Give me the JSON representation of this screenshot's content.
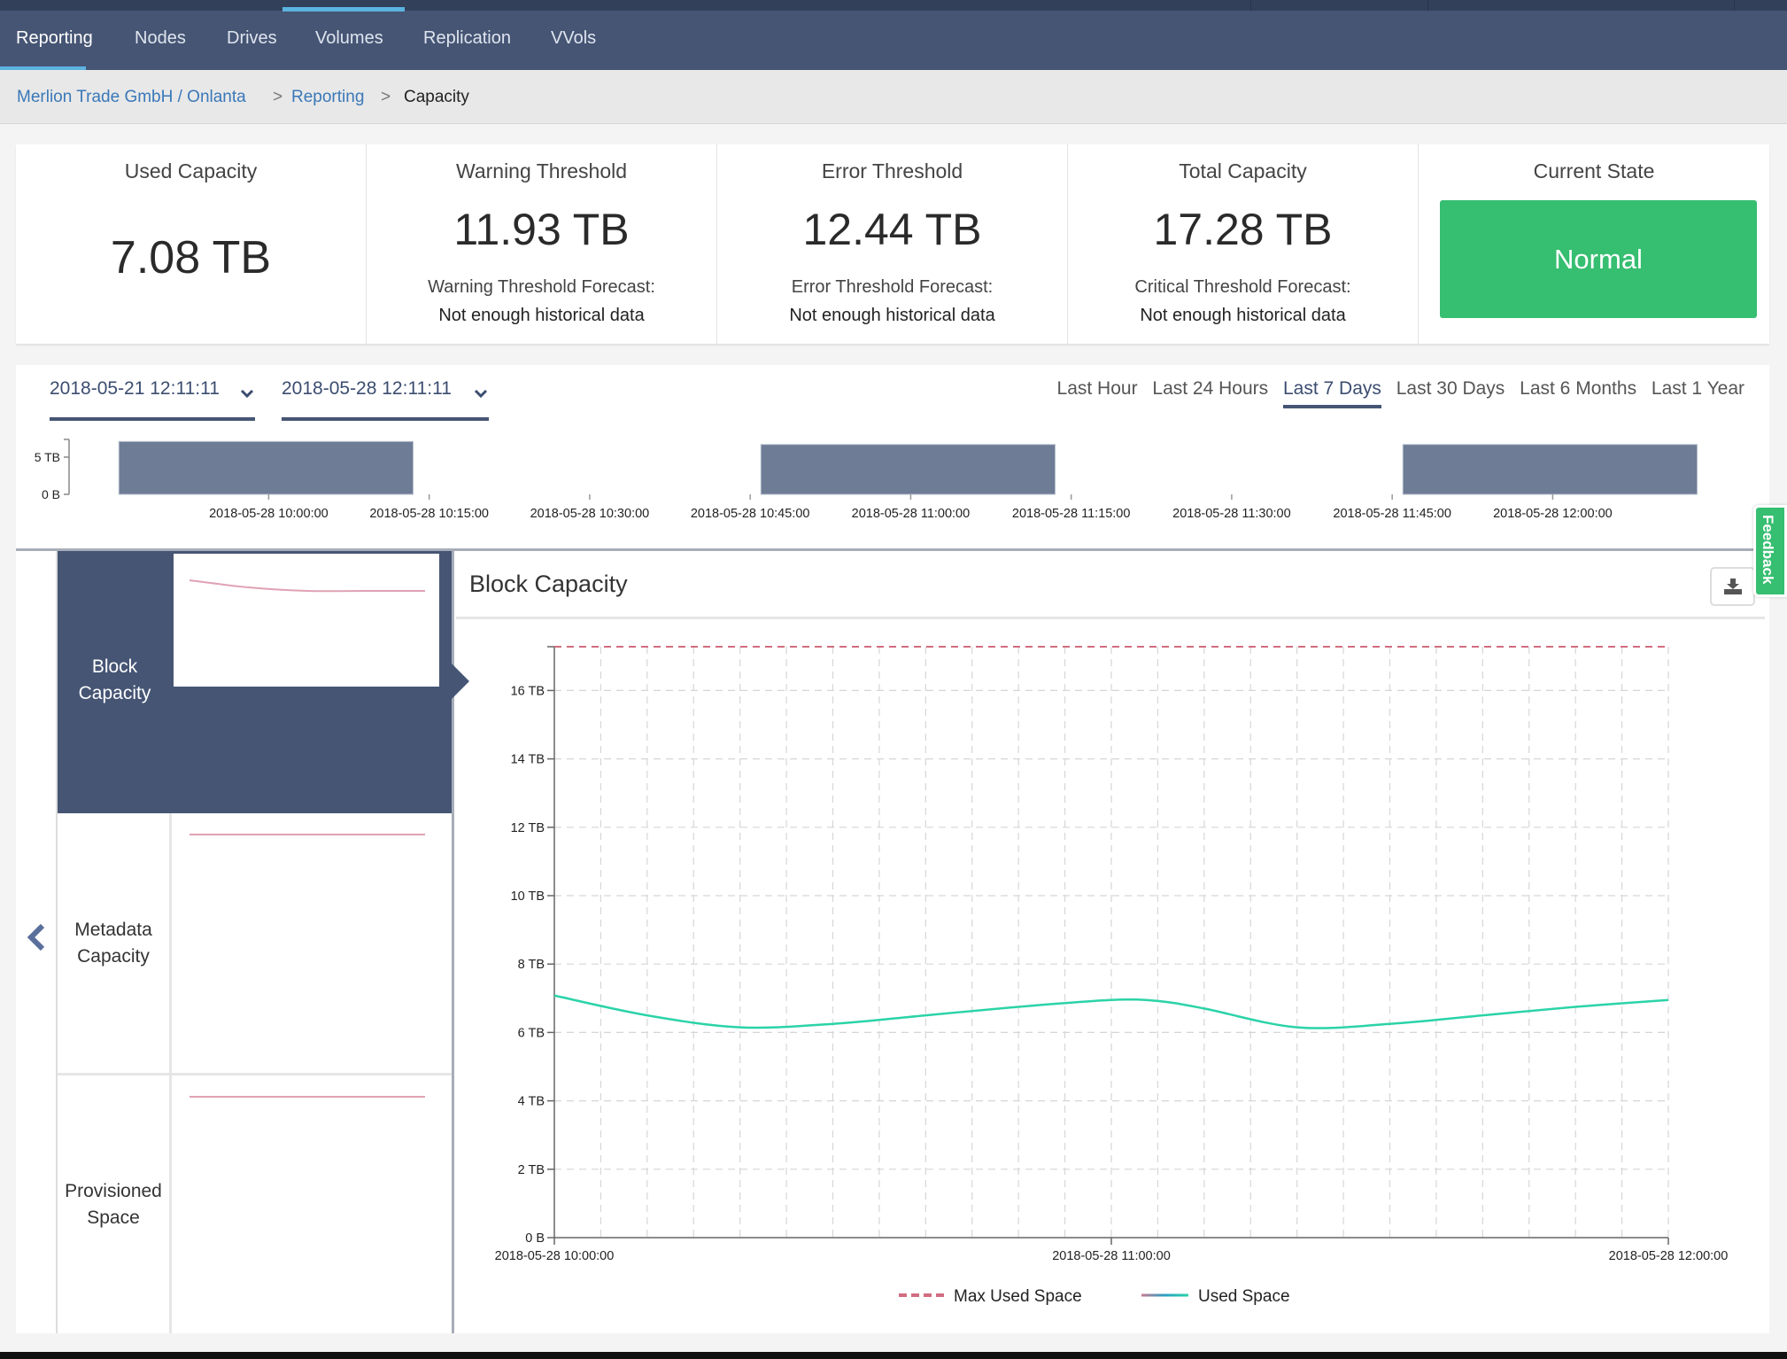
{
  "nav": {
    "tabs": [
      {
        "label": "Reporting",
        "active": true
      },
      {
        "label": "Nodes",
        "active": false
      },
      {
        "label": "Drives",
        "active": false
      },
      {
        "label": "Volumes",
        "active": false
      },
      {
        "label": "Replication",
        "active": false
      },
      {
        "label": "VVols",
        "active": false
      }
    ]
  },
  "breadcrumb": {
    "items": [
      "Merlion Trade GmbH / Onlanta",
      "Reporting",
      "Capacity"
    ],
    "separator": ">"
  },
  "stats": {
    "used": {
      "title": "Used Capacity",
      "value": "7.08 TB"
    },
    "warning": {
      "title": "Warning Threshold",
      "value": "11.93 TB",
      "forecast_label": "Warning Threshold Forecast:",
      "forecast_value": "Not enough historical data"
    },
    "error": {
      "title": "Error Threshold",
      "value": "12.44 TB",
      "forecast_label": "Error Threshold Forecast:",
      "forecast_value": "Not enough historical data"
    },
    "total": {
      "title": "Total Capacity",
      "value": "17.28 TB",
      "forecast_label": "Critical Threshold Forecast:",
      "forecast_value": "Not enough historical data"
    },
    "state": {
      "title": "Current State",
      "value": "Normal",
      "color": "#36be71"
    }
  },
  "range": {
    "start": "2018-05-21 12:11:11",
    "end": "2018-05-28 12:11:11",
    "options": [
      "Last Hour",
      "Last 24 Hours",
      "Last 7 Days",
      "Last 30 Days",
      "Last 6 Months",
      "Last 1 Year"
    ],
    "selected": "Last 7 Days"
  },
  "tiles": [
    {
      "label_lines": [
        "Block",
        "Capacity"
      ],
      "active": true,
      "spark": [
        0.92,
        0.88,
        0.86,
        0.86,
        0.86
      ]
    },
    {
      "label_lines": [
        "Metadata",
        "Capacity"
      ],
      "active": false,
      "spark": [
        0.95,
        0.95
      ]
    },
    {
      "label_lines": [
        "Provisioned",
        "Space"
      ],
      "active": false,
      "spark": [
        0.95,
        0.95
      ]
    }
  ],
  "detail": {
    "title": "Block Capacity",
    "download_icon": "download-icon"
  },
  "feedback_label": "Feedback",
  "chart_data": [
    {
      "type": "bar",
      "title": "",
      "ylabel": "",
      "y_ticks": [
        "0 B",
        "5 TB"
      ],
      "ylim_tb": [
        0,
        5
      ],
      "x_ticks": [
        "2018-05-28 10:00:00",
        "2018-05-28 10:15:00",
        "2018-05-28 10:30:00",
        "2018-05-28 10:45:00",
        "2018-05-28 11:00:00",
        "2018-05-28 11:15:00",
        "2018-05-28 11:30:00",
        "2018-05-28 11:45:00",
        "2018-05-28 12:00:00"
      ],
      "x_range_minutes": [
        -17,
        139
      ],
      "bars": [
        {
          "start_min": -14,
          "end_min": 13.5,
          "value_tb": 7.1
        },
        {
          "start_min": 46,
          "end_min": 73.5,
          "value_tb": 6.7
        },
        {
          "start_min": 106,
          "end_min": 133.5,
          "value_tb": 6.7
        }
      ],
      "color": "#6e7c96"
    },
    {
      "type": "line",
      "title": "Block Capacity",
      "xlabel": "",
      "ylabel": "",
      "x_ticks": [
        "2018-05-28 10:00:00",
        "2018-05-28 11:00:00",
        "2018-05-28 12:00:00"
      ],
      "x_range_minutes": [
        0,
        120
      ],
      "y_ticks": [
        "0 B",
        "2 TB",
        "4 TB",
        "6 TB",
        "8 TB",
        "10 TB",
        "12 TB",
        "14 TB",
        "16 TB"
      ],
      "ylim_tb": [
        0,
        17.28
      ],
      "grid": true,
      "legend": "bottom-center",
      "series": [
        {
          "name": "Max Used Space",
          "style": "dashed",
          "color": "#d26d80",
          "x_min": [
            0,
            120
          ],
          "y_tb": [
            17.28,
            17.28
          ]
        },
        {
          "name": "Used Space",
          "style": "solid",
          "color": "#2bd3a8",
          "x_min": [
            0,
            10,
            20,
            30,
            40,
            50,
            60,
            65,
            70,
            80,
            90,
            100,
            110,
            120
          ],
          "y_tb": [
            7.08,
            6.5,
            6.15,
            6.25,
            6.5,
            6.75,
            6.95,
            6.92,
            6.7,
            6.15,
            6.25,
            6.5,
            6.75,
            6.95
          ]
        }
      ]
    }
  ]
}
